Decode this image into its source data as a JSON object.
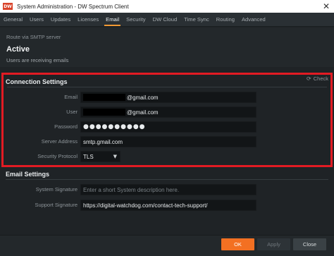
{
  "window": {
    "logo_text": "DW",
    "title": "System Administration - DW Spectrum Client",
    "close_glyph": "✕"
  },
  "tabs": [
    {
      "label": "General"
    },
    {
      "label": "Users"
    },
    {
      "label": "Updates"
    },
    {
      "label": "Licenses"
    },
    {
      "label": "Email",
      "active": true
    },
    {
      "label": "Security"
    },
    {
      "label": "DW Cloud"
    },
    {
      "label": "Time Sync"
    },
    {
      "label": "Routing"
    },
    {
      "label": "Advanced"
    }
  ],
  "header": {
    "route_text": "Route via SMTP server",
    "status": "Active",
    "status_desc": "Users are receiving emails"
  },
  "connection": {
    "title": "Connection Settings",
    "check_label": "Check",
    "check_icon": "refresh-icon",
    "email_label": "Email",
    "email_value": "@gmail.com",
    "user_label": "User",
    "user_value": "@gmail.com",
    "password_label": "Password",
    "password_value": "●●●●●●●●●●",
    "server_label": "Server Address",
    "server_value": "smtp.gmail.com",
    "protocol_label": "Security Protocol",
    "protocol_value": "TLS"
  },
  "email_settings": {
    "title": "Email Settings",
    "system_signature_label": "System Signature",
    "system_signature_placeholder": "Enter a short System description here.",
    "support_signature_label": "Support Signature",
    "support_signature_value": "https://digital-watchdog.com/contact-tech-support/"
  },
  "footer": {
    "ok_label": "OK",
    "apply_label": "Apply",
    "close_label": "Close"
  },
  "colors": {
    "accent": "#f37022",
    "highlight_border": "#e21b23",
    "background": "#1f2326"
  }
}
